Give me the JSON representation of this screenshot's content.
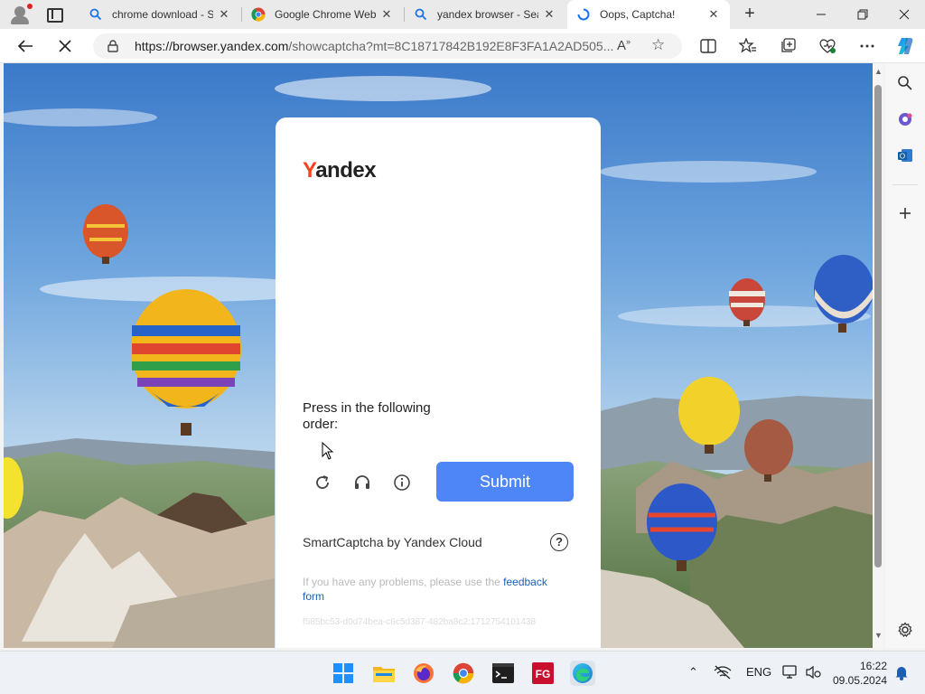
{
  "browser": {
    "tabs": [
      {
        "title": "chrome download - S",
        "favicon": "search-icon"
      },
      {
        "title": "Google Chrome Web",
        "favicon": "chrome-icon"
      },
      {
        "title": "yandex browser - Sea",
        "favicon": "search-icon"
      },
      {
        "title": "Oops, Captcha!",
        "favicon": "loading-icon",
        "active": true
      }
    ],
    "address": {
      "host": "https://browser.yandex.com",
      "path": "/showcaptcha?mt=8C18717842B192E8F3FA1A2AD505..."
    }
  },
  "captcha": {
    "logo_first": "Y",
    "logo_rest": "andex",
    "instruction": "Press in the following order:",
    "submit_label": "Submit",
    "brand": "SmartCaptcha by Yandex Cloud",
    "help_symbol": "?",
    "problem_text": "If you have any problems, please use the",
    "feedback_link": "feedback form",
    "hash": "f585bc53-d0d74bea-c6c5d387-482ba8c2:1712754101438"
  },
  "taskbar": {
    "language": "ENG",
    "time": "16:22",
    "date": "09.05.2024"
  },
  "colors": {
    "accent": "#4f86f7",
    "yandex_red": "#fc3f1d"
  }
}
